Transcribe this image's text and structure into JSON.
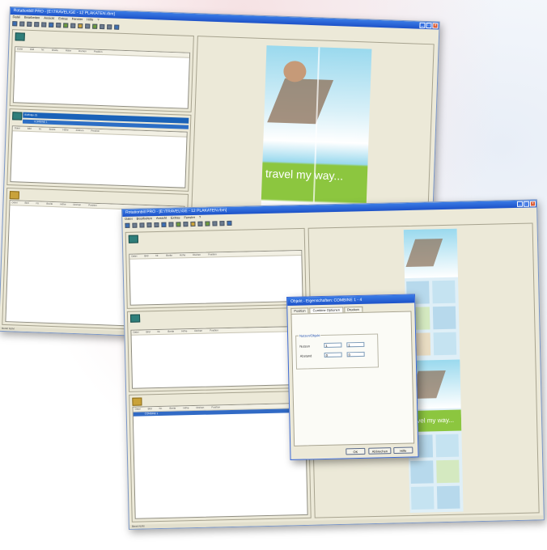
{
  "back_window": {
    "title": "Rotationbill PRO - [E:\\TRAVEL\\GE - 12 PLAKATEN.rbm]",
    "menu": [
      "Datei",
      "Bearbeiten",
      "Ansicht",
      "Extras",
      "Fenster",
      "Hilfe",
      "?"
    ],
    "pane1_columns": [
      "Datei",
      "Bild",
      "Nr.",
      "Breite",
      "Höhe",
      "Drehen",
      "Position"
    ],
    "pane2_strip_label": "Bildfolge (1)",
    "pane2_row": "COMBINE 1",
    "pane2_columns": [
      "Datei",
      "Bild",
      "Nr.",
      "Breite",
      "Höhe",
      "Drehen",
      "Position"
    ],
    "pane3_columns": [
      "Datei",
      "Bild",
      "Nr.",
      "Breite",
      "Höhe",
      "Drehen",
      "Position"
    ],
    "poster_caption": "travel my way...",
    "status": "Bereit NUM"
  },
  "front_window": {
    "title": "Rotationbill PRO - [E:\\TRAVEL\\GE - 12 PLAKATEN.rbm]",
    "menu": [
      "Datei",
      "Bearbeiten",
      "Ansicht",
      "Extras",
      "Fenster",
      "?"
    ],
    "pane1_columns": [
      "Datei",
      "Bild",
      "Nr.",
      "Breite",
      "Höhe",
      "Drehen",
      "Position"
    ],
    "pane2_columns": [
      "Datei",
      "Bild",
      "Nr.",
      "Breite",
      "Höhe",
      "Drehen",
      "Position"
    ],
    "pane3_columns": [
      "Datei",
      "Bild",
      "Nr.",
      "Breite",
      "Höhe",
      "Drehen",
      "Position"
    ],
    "pane3_selected_row": "COMBINE 1",
    "poster_caption": "travel my way...",
    "status": "Bereit NUM"
  },
  "dialog": {
    "title": "Objekt - Eigenschaften: COMBINE 1 - 4",
    "tabs": [
      "Position",
      "Combine Optionen",
      "Drucken"
    ],
    "group_label": "Nutzen/Objekt",
    "fields": [
      {
        "label": "Nutzen",
        "value": "1",
        "value2": "1"
      },
      {
        "label": "Abstand",
        "value": "0",
        "value2": "0"
      }
    ],
    "buttons": [
      "OK",
      "Abbrechen",
      "Hilfe"
    ]
  }
}
